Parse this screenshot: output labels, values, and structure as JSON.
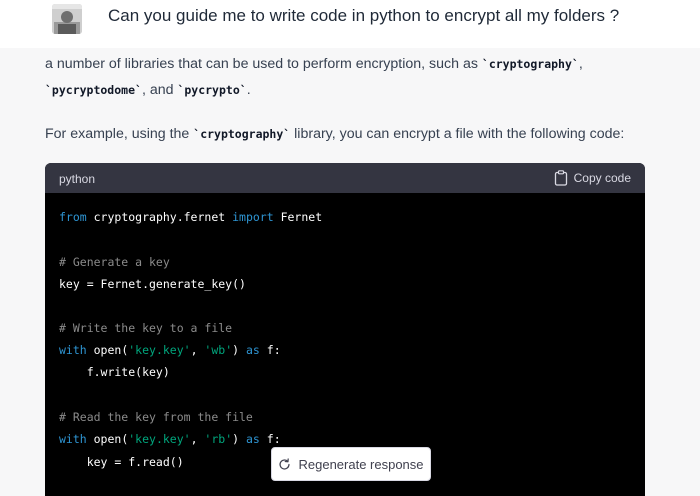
{
  "user": {
    "question": "Can you guide me to write code in python to encrypt all my folders ?",
    "avatar_icon": "user-photo-avatar"
  },
  "answer": {
    "p1_text1": "a number of libraries that can be used to perform encryption, such as ",
    "p1_code1": "`cryptography`",
    "p1_text2": ", ",
    "p1_code2": "`pycryptodome`",
    "p1_text3": ", and ",
    "p1_code3": "`pycrypto`",
    "p1_text4": ".",
    "p2_text1": "For example, using the ",
    "p2_code1": "`cryptography`",
    "p2_text2": " library, you can encrypt a file with the following code:"
  },
  "code_block": {
    "language": "python",
    "copy_label": "Copy code",
    "copy_icon": "clipboard-icon",
    "lines": {
      "l1_kw1": "from",
      "l1_pl1": " cryptography.fernet ",
      "l1_kw2": "import",
      "l1_pl2": " Fernet",
      "l2_cm": "# Generate a key",
      "l3_pl": "key = Fernet.generate_key()",
      "l4_cm": "# Write the key to a file",
      "l5_kw1": "with",
      "l5_pl1": " open(",
      "l5_st1": "'key.key'",
      "l5_pl2": ", ",
      "l5_st2": "'wb'",
      "l5_pl3": ") ",
      "l5_kw2": "as",
      "l5_pl4": " f:",
      "l6_pl": "    f.write(key)",
      "l7_cm": "# Read the key from the file",
      "l8_kw1": "with",
      "l8_pl1": " open(",
      "l8_st1": "'key.key'",
      "l8_pl2": ", ",
      "l8_st2": "'rb'",
      "l8_pl3": ") ",
      "l8_kw2": "as",
      "l8_pl4": " f:",
      "l9_pl": "    key = f.read()"
    }
  },
  "regenerate": {
    "label": "Regenerate response",
    "icon": "refresh-icon"
  },
  "colors": {
    "keyword": "#2e95d3",
    "comment": "#8b8b8b",
    "string": "#00a67d",
    "code_bg": "#000000",
    "code_header_bg": "#343541",
    "page_bg": "#f7f7f8"
  }
}
